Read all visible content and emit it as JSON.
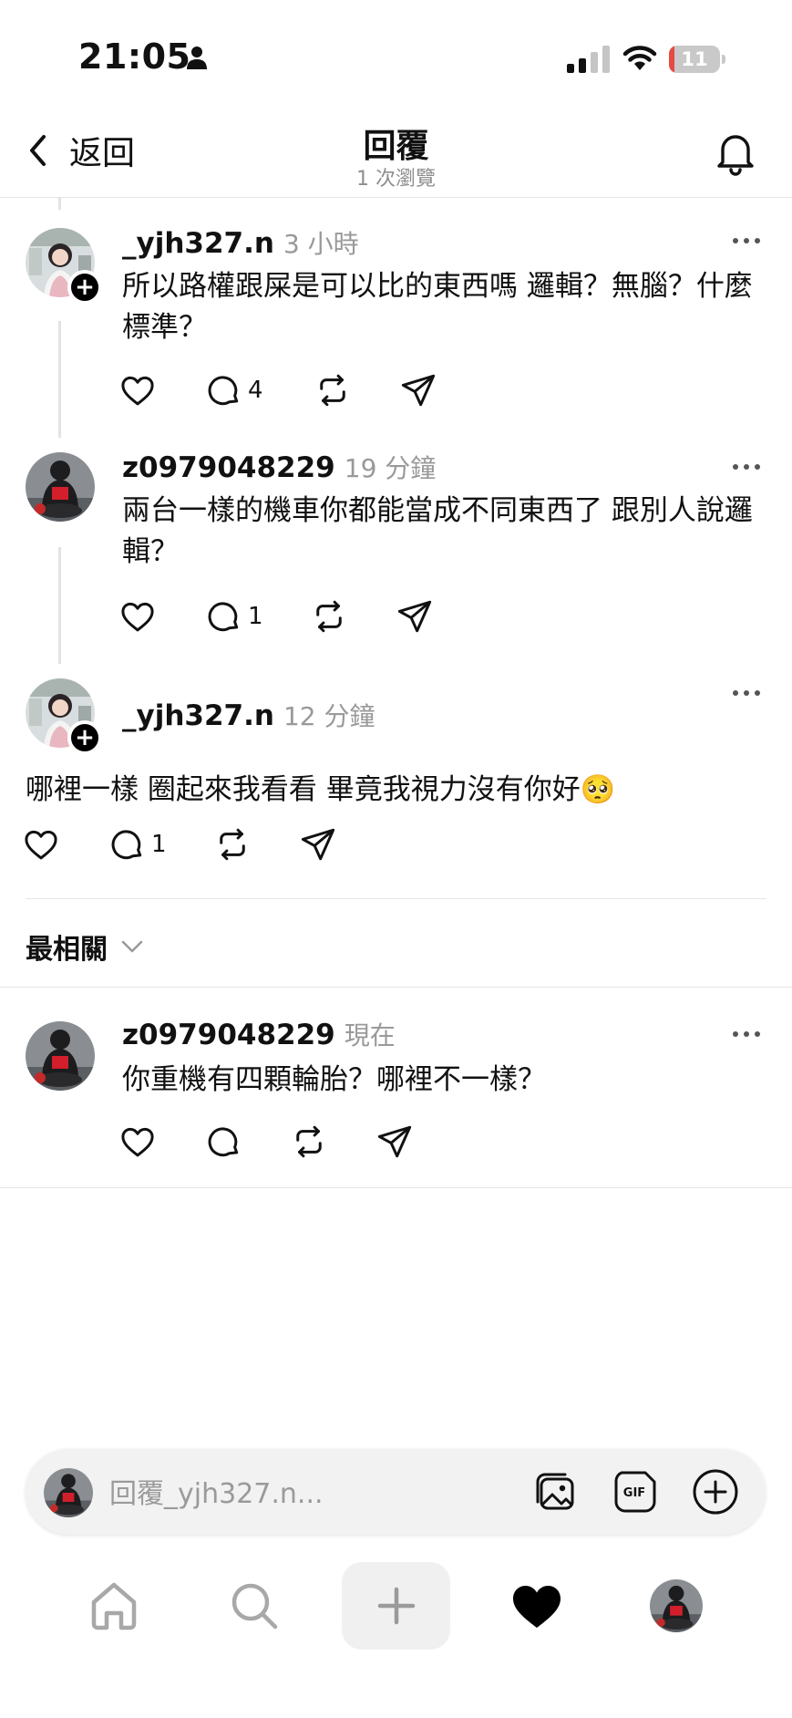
{
  "status_bar": {
    "time": "21:05",
    "battery": "11",
    "battery_level": 0.11
  },
  "header": {
    "back_label": "返回",
    "title": "回覆",
    "subtitle": "1 次瀏覽"
  },
  "posts": [
    {
      "username": "_yjh327.n",
      "time": "3 小時",
      "text": "所以路權跟屎是可以比的東西嗎 邏輯？無腦？什麼標準？",
      "reply_count": "4"
    },
    {
      "username": "z0979048229",
      "time": "19 分鐘",
      "text": "兩台一樣的機車你都能當成不同東西了 跟別人說邏輯？",
      "reply_count": "1"
    },
    {
      "username": "_yjh327.n",
      "time": "12 分鐘",
      "text": "哪裡一樣 圈起來我看看 畢竟我視力沒有你好🥺",
      "reply_count": "1"
    },
    {
      "username": "z0979048229",
      "time": "現在",
      "text": "你重機有四顆輪胎？哪裡不一樣？",
      "reply_count": ""
    }
  ],
  "sort": {
    "label": "最相關"
  },
  "reply": {
    "placeholder": "回覆_yjh327.n..."
  },
  "colors": {
    "accent": "#000000",
    "battery_red": "#e64a43",
    "muted": "#999999"
  }
}
